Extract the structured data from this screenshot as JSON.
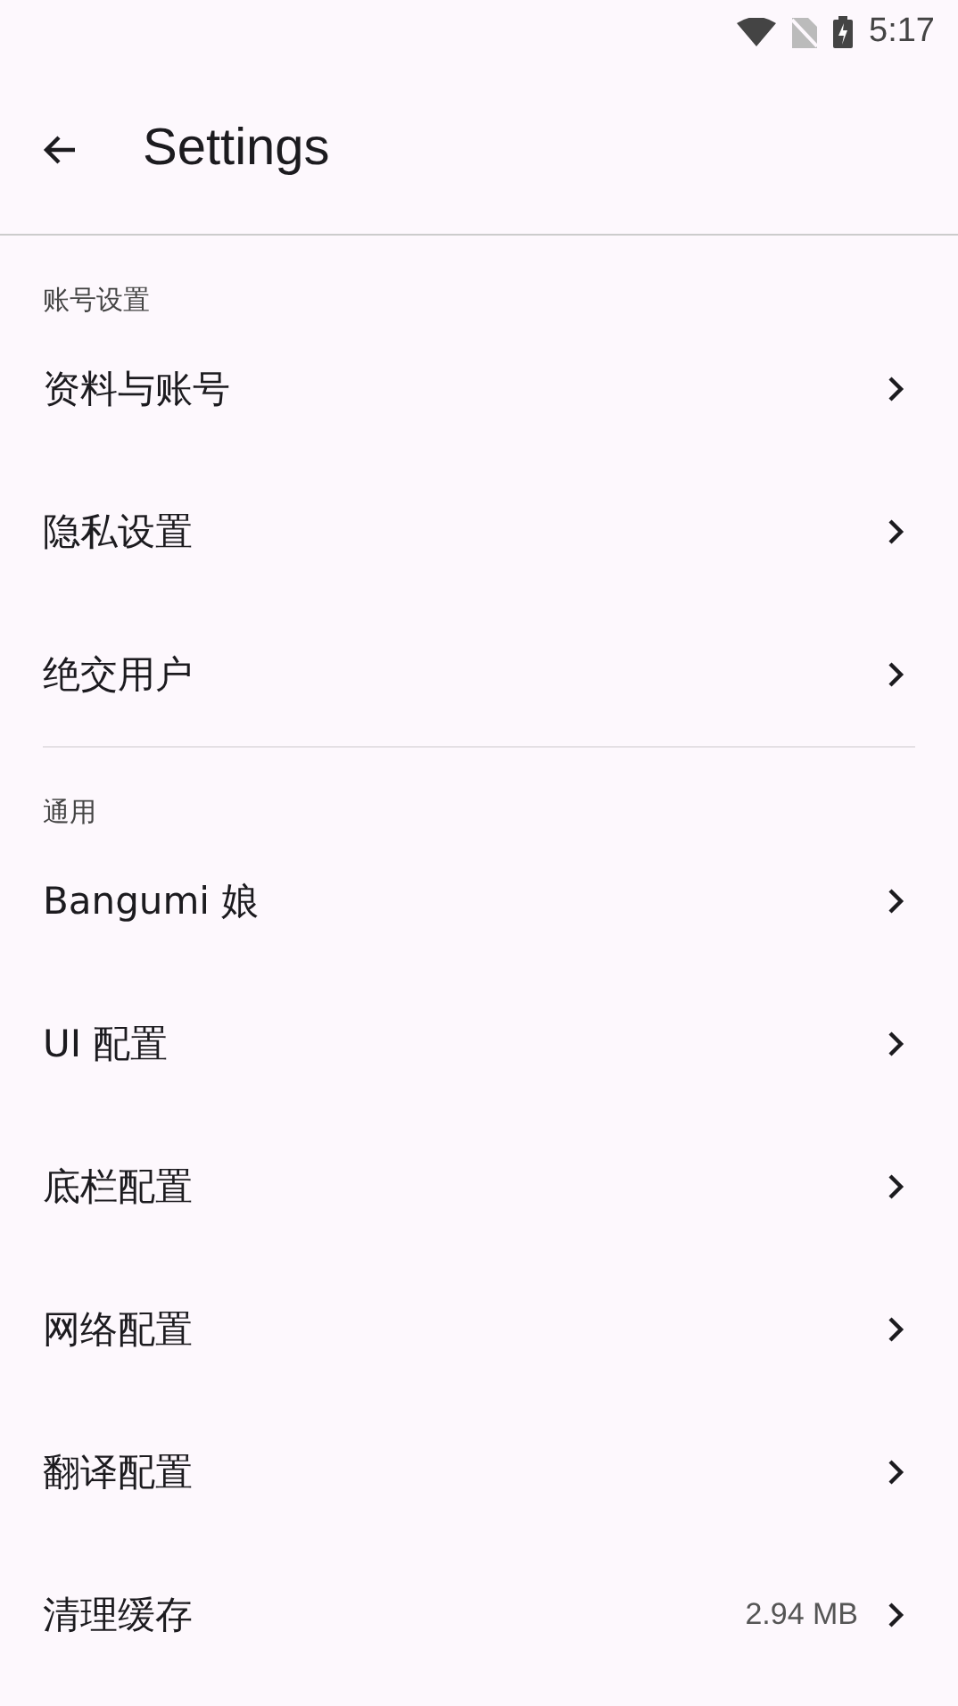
{
  "status_bar": {
    "time": "5:17"
  },
  "app_bar": {
    "title": "Settings"
  },
  "sections": [
    {
      "header": "账号设置",
      "items": [
        {
          "label": "资料与账号"
        },
        {
          "label": "隐私设置"
        },
        {
          "label": "绝交用户"
        }
      ]
    },
    {
      "header": "通用",
      "items": [
        {
          "label": "Bangumi 娘"
        },
        {
          "label": "UI 配置"
        },
        {
          "label": "底栏配置"
        },
        {
          "label": "网络配置"
        },
        {
          "label": "翻译配置"
        },
        {
          "label": "清理缓存",
          "value": "2.94 MB"
        }
      ]
    }
  ]
}
